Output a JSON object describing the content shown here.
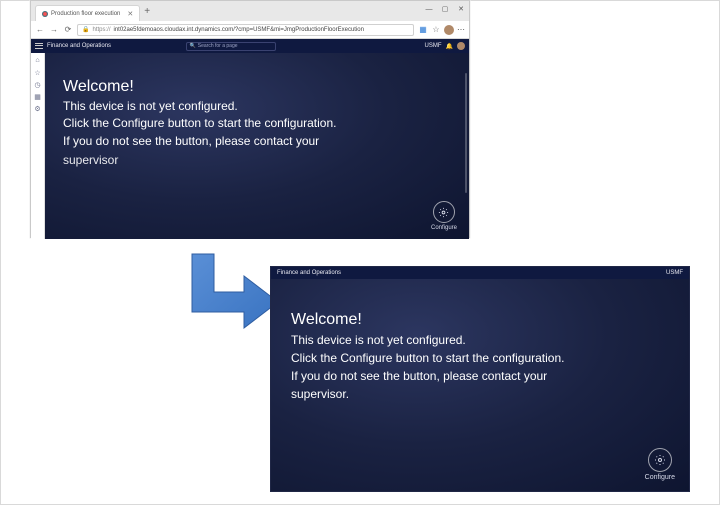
{
  "browser": {
    "tab_title": "Production floor execution",
    "url_prefix": "https://",
    "url": "int02ae5fdemoaos.cloudax.int.dynamics.com/?cmp=USMF&mi=JmgProductionFloorExecution",
    "window_controls": {
      "min": "—",
      "max": "▢",
      "close": "✕"
    },
    "nav": {
      "back": "←",
      "forward": "→",
      "refresh": "⟳"
    }
  },
  "app": {
    "brand": "Finance and Operations",
    "search_placeholder": "Search for a page",
    "company_code": "USMF",
    "leftrail_icons": [
      "home-icon",
      "star-icon",
      "clock-icon",
      "grid-icon",
      "gear-icon"
    ]
  },
  "welcome_top": {
    "title": "Welcome!",
    "line1": "This device is not yet configured.",
    "line2": "Click the Configure button to start the configuration.",
    "line3": "If you do not see the button, please contact your",
    "line4_clipped": "supervisor"
  },
  "welcome_bottom": {
    "title": "Welcome!",
    "line1": "This device is not yet configured.",
    "line2": "Click the Configure button to start the configuration.",
    "line3": "If you do not see the button, please contact your",
    "line4": "supervisor."
  },
  "configure_label": "Configure",
  "fullscreen": {
    "brand": "Finance and Operations",
    "company_code": "USMF"
  }
}
